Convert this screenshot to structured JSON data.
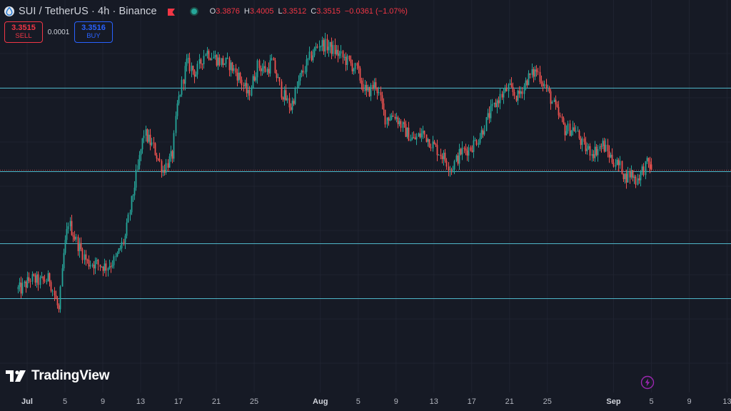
{
  "header": {
    "symbol_icon": "sui-drop-icon",
    "title": "SUI / TetherUS · 4h · Binance",
    "ohlc": [
      {
        "k": "O",
        "v": "3.3876"
      },
      {
        "k": "H",
        "v": "3.4005"
      },
      {
        "k": "L",
        "v": "3.3512"
      },
      {
        "k": "C",
        "v": "3.3515"
      },
      {
        "k": "",
        "v": "−0.0361 (−1.07%)"
      }
    ]
  },
  "trade": {
    "sell_price": "3.3515",
    "sell_label": "SELL",
    "spread": "0.0001",
    "buy_price": "3.3516",
    "buy_label": "BUY"
  },
  "branding": {
    "logo_text": "TradingView"
  },
  "colors": {
    "background": "#161a25",
    "up": "#26a69a",
    "down": "#ef5350",
    "level_line": "#4fb7c9",
    "price_line": "#ef5350"
  },
  "chart_data": {
    "type": "candlestick",
    "symbol": "SUI / TetherUS",
    "interval": "4h",
    "exchange": "Binance",
    "ylim": [
      2.0,
      4.3
    ],
    "x_ticks": [
      {
        "label": "Jul",
        "day": 0,
        "bold": true
      },
      {
        "label": "5",
        "day": 4
      },
      {
        "label": "9",
        "day": 8
      },
      {
        "label": "13",
        "day": 12
      },
      {
        "label": "17",
        "day": 16
      },
      {
        "label": "21",
        "day": 20
      },
      {
        "label": "25",
        "day": 24
      },
      {
        "label": "Aug",
        "day": 31,
        "bold": true
      },
      {
        "label": "5",
        "day": 35
      },
      {
        "label": "9",
        "day": 39
      },
      {
        "label": "13",
        "day": 43
      },
      {
        "label": "17",
        "day": 47
      },
      {
        "label": "21",
        "day": 51
      },
      {
        "label": "25",
        "day": 55
      },
      {
        "label": "Sep",
        "day": 62,
        "bold": true
      },
      {
        "label": "5",
        "day": 66
      },
      {
        "label": "9",
        "day": 70
      },
      {
        "label": "13",
        "day": 74
      }
    ],
    "horizontal_levels": [
      3.9,
      3.34,
      2.86,
      2.49
    ],
    "last_price": 3.3515,
    "anchors": [
      [
        -0.5,
        2.55
      ],
      [
        0.5,
        2.62
      ],
      [
        1.5,
        2.6
      ],
      [
        2.5,
        2.62
      ],
      [
        3.5,
        2.4
      ],
      [
        4.0,
        2.78
      ],
      [
        4.5,
        3.0
      ],
      [
        5.5,
        2.85
      ],
      [
        6.5,
        2.73
      ],
      [
        7.5,
        2.72
      ],
      [
        8.5,
        2.7
      ],
      [
        9.5,
        2.75
      ],
      [
        10.5,
        2.9
      ],
      [
        11.5,
        3.25
      ],
      [
        12.5,
        3.6
      ],
      [
        13.5,
        3.5
      ],
      [
        14.5,
        3.35
      ],
      [
        15.5,
        3.45
      ],
      [
        16.0,
        3.78
      ],
      [
        17.0,
        4.07
      ],
      [
        18.0,
        4.0
      ],
      [
        19.0,
        4.15
      ],
      [
        20.5,
        4.08
      ],
      [
        21.5,
        4.06
      ],
      [
        22.5,
        3.98
      ],
      [
        23.5,
        3.85
      ],
      [
        24.5,
        4.05
      ],
      [
        25.5,
        4.02
      ],
      [
        26.0,
        4.08
      ],
      [
        27.0,
        3.88
      ],
      [
        28.0,
        3.77
      ],
      [
        29.0,
        3.97
      ],
      [
        30.0,
        4.1
      ],
      [
        31.0,
        4.2
      ],
      [
        32.0,
        4.18
      ],
      [
        33.0,
        4.13
      ],
      [
        34.0,
        4.08
      ],
      [
        35.0,
        4.02
      ],
      [
        36.0,
        3.86
      ],
      [
        37.0,
        3.93
      ],
      [
        38.0,
        3.7
      ],
      [
        39.0,
        3.72
      ],
      [
        40.0,
        3.62
      ],
      [
        41.0,
        3.55
      ],
      [
        42.0,
        3.6
      ],
      [
        43.0,
        3.52
      ],
      [
        44.0,
        3.45
      ],
      [
        45.0,
        3.36
      ],
      [
        46.0,
        3.47
      ],
      [
        47.0,
        3.5
      ],
      [
        48.0,
        3.58
      ],
      [
        49.0,
        3.72
      ],
      [
        50.0,
        3.83
      ],
      [
        51.0,
        3.9
      ],
      [
        52.0,
        3.84
      ],
      [
        53.0,
        3.96
      ],
      [
        54.0,
        4.02
      ],
      [
        55.0,
        3.9
      ],
      [
        56.0,
        3.76
      ],
      [
        57.0,
        3.62
      ],
      [
        58.0,
        3.63
      ],
      [
        59.0,
        3.5
      ],
      [
        60.0,
        3.47
      ],
      [
        61.0,
        3.52
      ],
      [
        62.0,
        3.42
      ],
      [
        63.0,
        3.36
      ],
      [
        63.3,
        3.3
      ],
      [
        64.0,
        3.33
      ],
      [
        64.5,
        3.28
      ],
      [
        65.2,
        3.35
      ],
      [
        65.8,
        3.4
      ],
      [
        66.0,
        3.38
      ]
    ]
  }
}
